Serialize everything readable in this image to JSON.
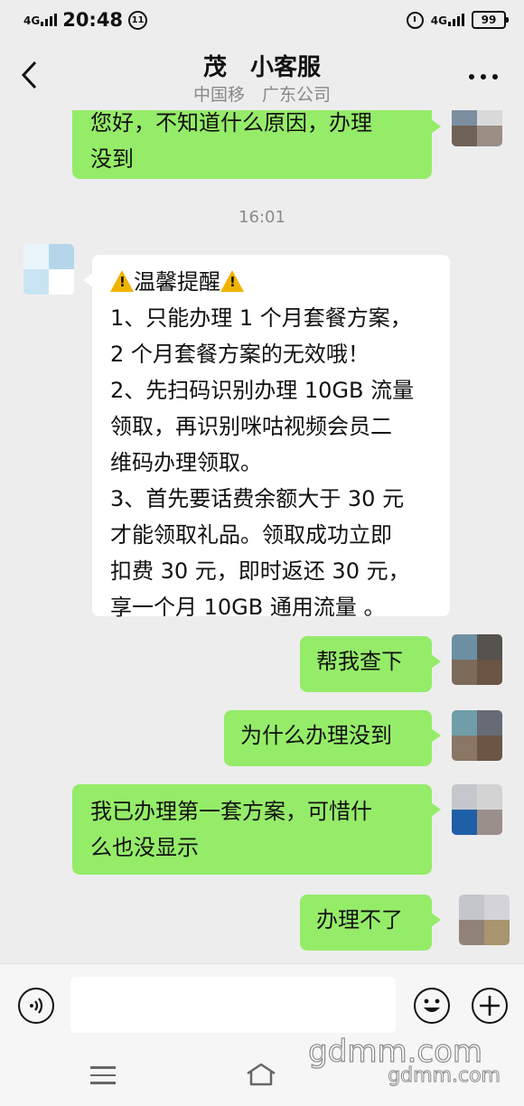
{
  "status_bar": {
    "network": "4G",
    "time": "20:48",
    "notification_glyph": "⑪",
    "right_network": "4G",
    "battery": "99"
  },
  "header": {
    "title": "茂　小客服",
    "subtitle": "中国移　广东公司"
  },
  "chat": {
    "timestamp": "16:01",
    "messages": [
      {
        "side": "out",
        "lines": [
          "您好，不知道什么原因，办理",
          "没到"
        ]
      },
      {
        "side": "in",
        "heading": "温馨提醒",
        "lines": [
          "1、只能办理 1 个月套餐方案，",
          "2 个月套餐方案的无效哦！",
          "2、先扫码识别办理 10GB 流量",
          "领取，再识别咪咕视频会员二",
          "维码办理领取。",
          "3、首先要话费余额大于 30 元",
          "才能领取礼品。领取成功立即",
          "扣费 30 元，即时返还 30 元，",
          "享一个月 10GB 通用流量 。"
        ]
      },
      {
        "side": "out",
        "lines": [
          "帮我查下"
        ]
      },
      {
        "side": "out",
        "lines": [
          "为什么办理没到"
        ]
      },
      {
        "side": "out",
        "lines": [
          "我已办理第一套方案，可惜什",
          "么也没显示"
        ]
      },
      {
        "side": "out",
        "lines": [
          "办理不了"
        ]
      }
    ]
  },
  "input_bar": {
    "voice_icon": "voice-icon",
    "emoji_icon": "emoji-icon",
    "plus_icon": "plus-icon"
  },
  "watermark": {
    "large": "gdmm.com",
    "small": "gdmm.com"
  },
  "colors": {
    "outgoing_bubble": "#95ec69",
    "incoming_bubble": "#ffffff",
    "background": "#ededed",
    "warning": "#f0b400"
  }
}
